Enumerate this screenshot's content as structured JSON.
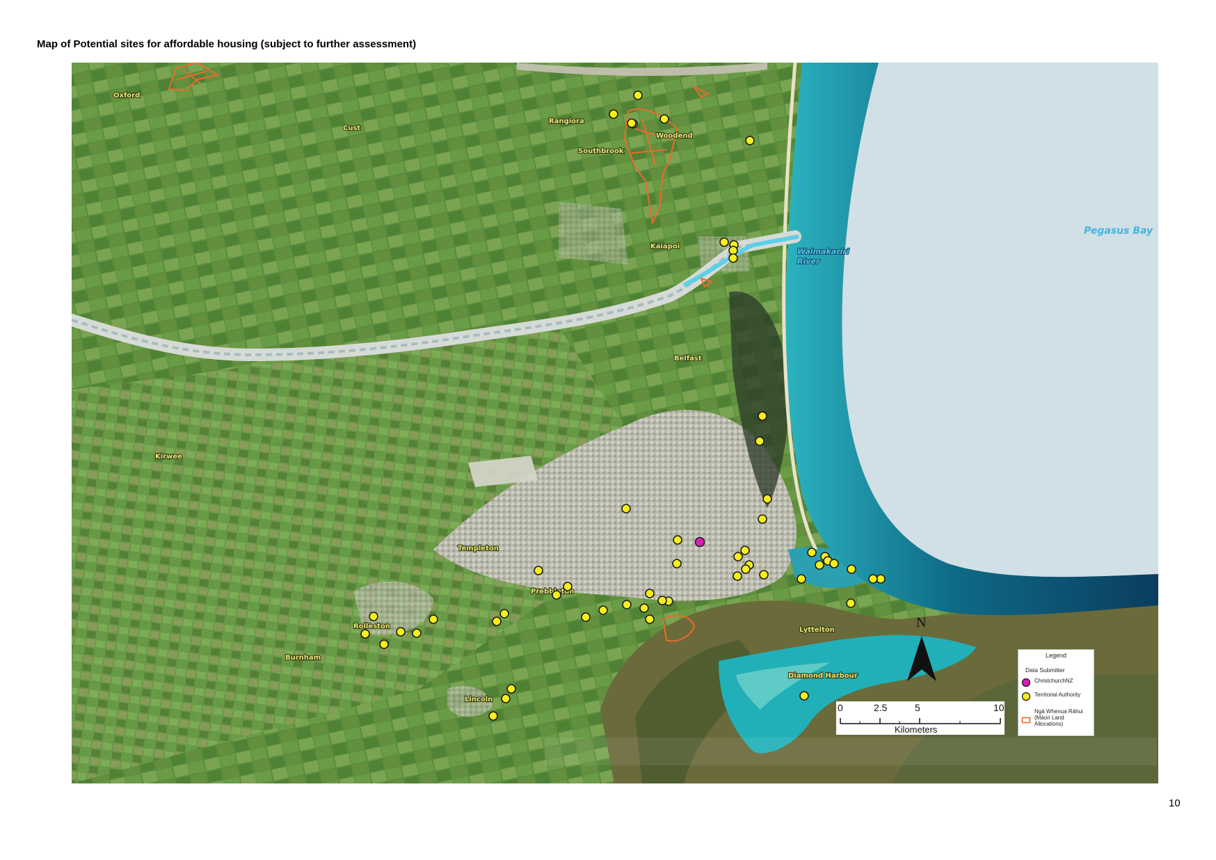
{
  "page": {
    "title": "Map of Potential sites for affordable housing (subject to further assessment)",
    "page_number": "10"
  },
  "map": {
    "place_names": [
      {
        "id": "oxford",
        "text": "Oxford"
      },
      {
        "id": "cust",
        "text": "Cust"
      },
      {
        "id": "rangiora",
        "text": "Rangiora"
      },
      {
        "id": "southbrook",
        "text": "Southbrook"
      },
      {
        "id": "woodend",
        "text": "Woodend"
      },
      {
        "id": "kaiapoi",
        "text": "Kaiapoi"
      },
      {
        "id": "belfast",
        "text": "Belfast"
      },
      {
        "id": "kirwee",
        "text": "Kirwee"
      },
      {
        "id": "templeton",
        "text": "Templeton"
      },
      {
        "id": "prebbleton",
        "text": "Prebbleton"
      },
      {
        "id": "rolleston",
        "text": "Rolleston"
      },
      {
        "id": "burnham",
        "text": "Burnham"
      },
      {
        "id": "lincoln",
        "text": "Lincoln"
      },
      {
        "id": "lyttelton",
        "text": "Lyttelton"
      },
      {
        "id": "diamond_harbour",
        "text": "Diamond Harbour"
      }
    ],
    "water_labels": {
      "pegasus_bay": "Pegasus Bay",
      "waimakariri_1": "Waimakariri",
      "waimakariri_2": "River"
    },
    "colors": {
      "territorial_authority": "#f6ef1c",
      "christchurch_nz": "#d81fb5",
      "maori_land": "#ee6a2a",
      "sea": "#d1dfe6",
      "farmland": "#5c8f3e"
    },
    "christchurch_site_count": 1,
    "territorial_authority_site_count": 56
  },
  "legend": {
    "title": "Legend",
    "subtitle": "Data Submitter",
    "items": [
      {
        "label": "ChristchurchNZ",
        "symbol": "magenta-circle-icon"
      },
      {
        "label": "Territorial Authority",
        "symbol": "yellow-circle-icon"
      },
      {
        "label": "Ngā Whenua Rāhui (Māori Land Allocations)",
        "symbol": "orange-outline-box-icon"
      }
    ]
  },
  "scalebar": {
    "ticks": [
      "0",
      "2.5",
      "5",
      "10"
    ],
    "units": "Kilometers"
  },
  "north_arrow": {
    "label": "N"
  }
}
